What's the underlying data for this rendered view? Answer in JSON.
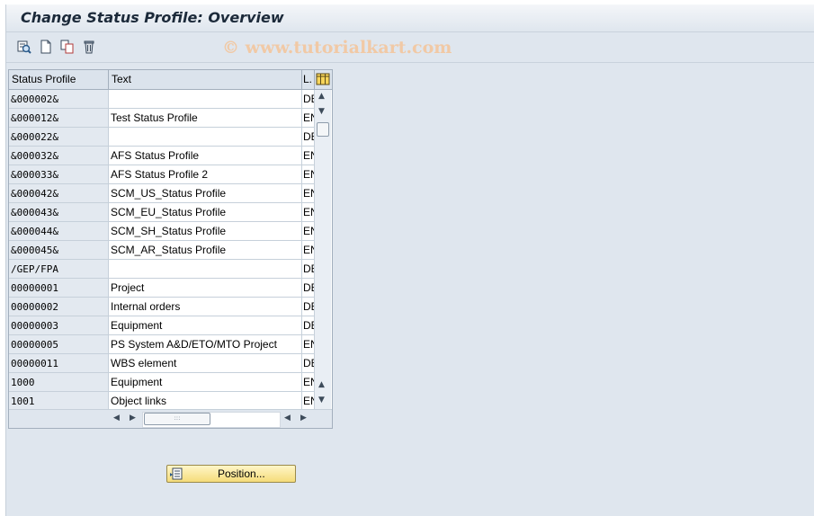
{
  "window": {
    "title": "Change Status Profile: Overview"
  },
  "toolbar": {
    "watermark": "© www.tutorialkart.com",
    "buttons": [
      {
        "icon": "details-icon"
      },
      {
        "icon": "new-entries-icon"
      },
      {
        "icon": "copy-icon"
      },
      {
        "icon": "delete-icon"
      }
    ]
  },
  "table": {
    "columns": {
      "status_profile": "Status Profile",
      "text": "Text",
      "lang": "L."
    },
    "rows": [
      {
        "key": "&000002&",
        "text": "",
        "lang": "DE"
      },
      {
        "key": "&000012&",
        "text": "Test Status Profile",
        "lang": "EN"
      },
      {
        "key": "&000022&",
        "text": "",
        "lang": "DE"
      },
      {
        "key": "&000032&",
        "text": "AFS Status Profile",
        "lang": "EN"
      },
      {
        "key": "&000033&",
        "text": "AFS Status Profile 2",
        "lang": "EN"
      },
      {
        "key": "&000042&",
        "text": "SCM_US_Status Profile",
        "lang": "EN"
      },
      {
        "key": "&000043&",
        "text": "SCM_EU_Status Profile",
        "lang": "EN"
      },
      {
        "key": "&000044&",
        "text": "SCM_SH_Status Profile",
        "lang": "EN"
      },
      {
        "key": "&000045&",
        "text": "SCM_AR_Status Profile",
        "lang": "EN"
      },
      {
        "key": "/GEP/FPA",
        "text": "",
        "lang": "DE"
      },
      {
        "key": "00000001",
        "text": "Project",
        "lang": "DE"
      },
      {
        "key": "00000002",
        "text": "Internal orders",
        "lang": "DE"
      },
      {
        "key": "00000003",
        "text": "Equipment",
        "lang": "DE"
      },
      {
        "key": "00000005",
        "text": "PS System A&D/ETO/MTO Project",
        "lang": "EN"
      },
      {
        "key": "00000011",
        "text": "WBS element",
        "lang": "DE"
      },
      {
        "key": "1000",
        "text": "Equipment",
        "lang": "EN"
      },
      {
        "key": "1001",
        "text": "Object links",
        "lang": "EN"
      }
    ]
  },
  "buttons": {
    "position_label": "Position..."
  }
}
